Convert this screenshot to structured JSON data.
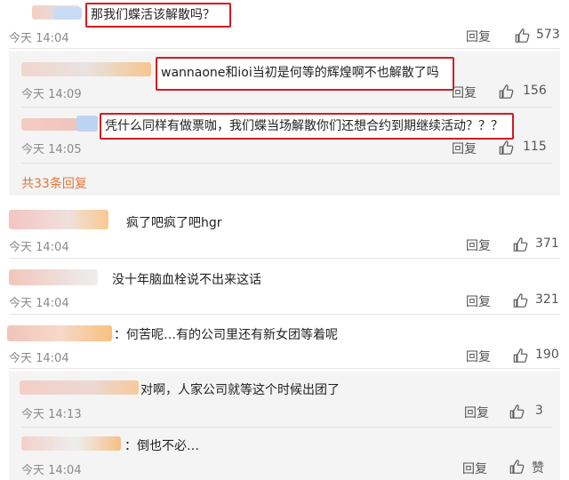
{
  "comments": [
    {
      "user": "",
      "text": "那我们蝶活该解散吗？",
      "time": "今天 14:04",
      "reply": "回复",
      "likes": "573"
    },
    {
      "user": "",
      "text": "wannaone和ioi当初是何等的辉煌啊不也解散了吗",
      "time": "今天 14:09",
      "reply": "回复",
      "likes": "156"
    },
    {
      "user": "",
      "text": "凭什么同样有做票咖，我们蝶当场解散你们还想合约到期继续活动？？？",
      "time": "今天 14:05",
      "reply": "回复",
      "likes": "115"
    },
    {
      "user": "",
      "text": "疯了吧疯了吧hgr",
      "time": "今天 14:04",
      "reply": "回复",
      "likes": "371"
    },
    {
      "user": "",
      "text": "没十年脑血栓说不出来这话",
      "time": "今天 14:04",
      "reply": "回复",
      "likes": "321"
    },
    {
      "user": "",
      "text": "：何苦呢…有的公司里还有新女团等着呢",
      "time": "今天 14:04",
      "reply": "回复",
      "likes": "190"
    },
    {
      "user": "",
      "text": "对啊，人家公司就等这个时候出团了",
      "time": "今天 14:13",
      "reply": "回复",
      "likes": "3"
    },
    {
      "user": "",
      "text": "：倒也不必…",
      "time": "今天 14:04",
      "reply": "回复",
      "likes": "赞"
    }
  ],
  "more_replies": "共33条回复",
  "colors": {
    "accent": "#e8743b",
    "highlight_border": "#d7191f",
    "avatar_blur_a": "#f9c9a8",
    "avatar_blur_b": "#c9d9f5"
  },
  "icons": {
    "like": "thumbs-up-icon"
  }
}
